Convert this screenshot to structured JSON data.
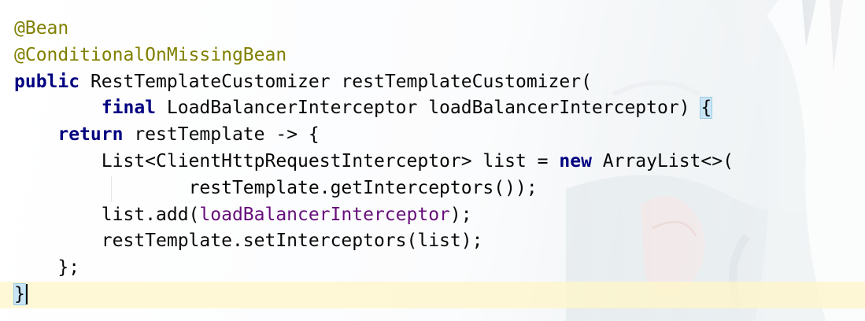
{
  "code": {
    "line1": {
      "annotation": "@Bean"
    },
    "line2": {
      "annotation": "@ConditionalOnMissingBean"
    },
    "line3": {
      "kw": "public",
      "text": " RestTemplateCustomizer restTemplateCustomizer("
    },
    "line4": {
      "indent": "        ",
      "kw": "final",
      "text": " LoadBalancerInterceptor loadBalancerInterceptor) ",
      "brace": "{"
    },
    "line5": {
      "indent": "    ",
      "kw": "return",
      "text": " restTemplate -> {"
    },
    "line6": {
      "indent": "        ",
      "text": "List<ClientHttpRequestInterceptor> list = ",
      "kw": "new",
      "text2": " ArrayList<>("
    },
    "line7": {
      "indent": "                ",
      "text": "restTemplate.getInterceptors());"
    },
    "line8": {
      "indent": "        ",
      "text": "list.add(",
      "field": "loadBalancerInterceptor",
      "text2": ");"
    },
    "line9": {
      "indent": "        ",
      "text": "restTemplate.setInterceptors(list);"
    },
    "line10": {
      "indent": "    ",
      "text": "};"
    },
    "line11": {
      "brace": "}"
    }
  },
  "colors": {
    "annotation": "#808000",
    "keyword": "#000080",
    "field": "#660e7a",
    "text": "#080808",
    "brace_highlight": "#c9e5f5",
    "current_line": "#fff6c8"
  }
}
